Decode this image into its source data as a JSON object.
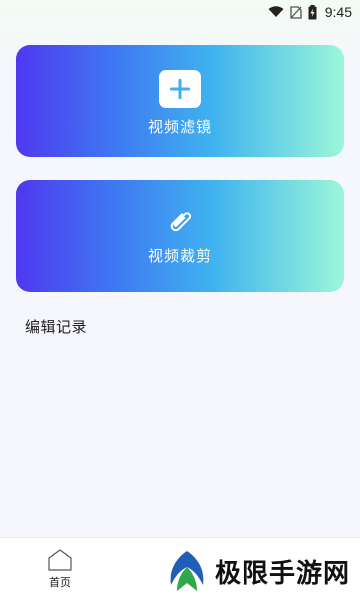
{
  "status_bar": {
    "time": "9:45"
  },
  "cards": [
    {
      "label": "视频滤镜",
      "icon": "plus-icon"
    },
    {
      "label": "视频裁剪",
      "icon": "paperclip-icon"
    }
  ],
  "section": {
    "title": "编辑记录"
  },
  "bottom_nav": {
    "items": [
      {
        "label": "首页",
        "icon": "home-icon"
      }
    ]
  },
  "watermark": {
    "text": "极限手游网"
  },
  "colors": {
    "gradient_start": "#4f38f0",
    "gradient_mid": "#3fb3ef",
    "gradient_end": "#9cf7d9",
    "plus_color": "#3fb0e8"
  }
}
